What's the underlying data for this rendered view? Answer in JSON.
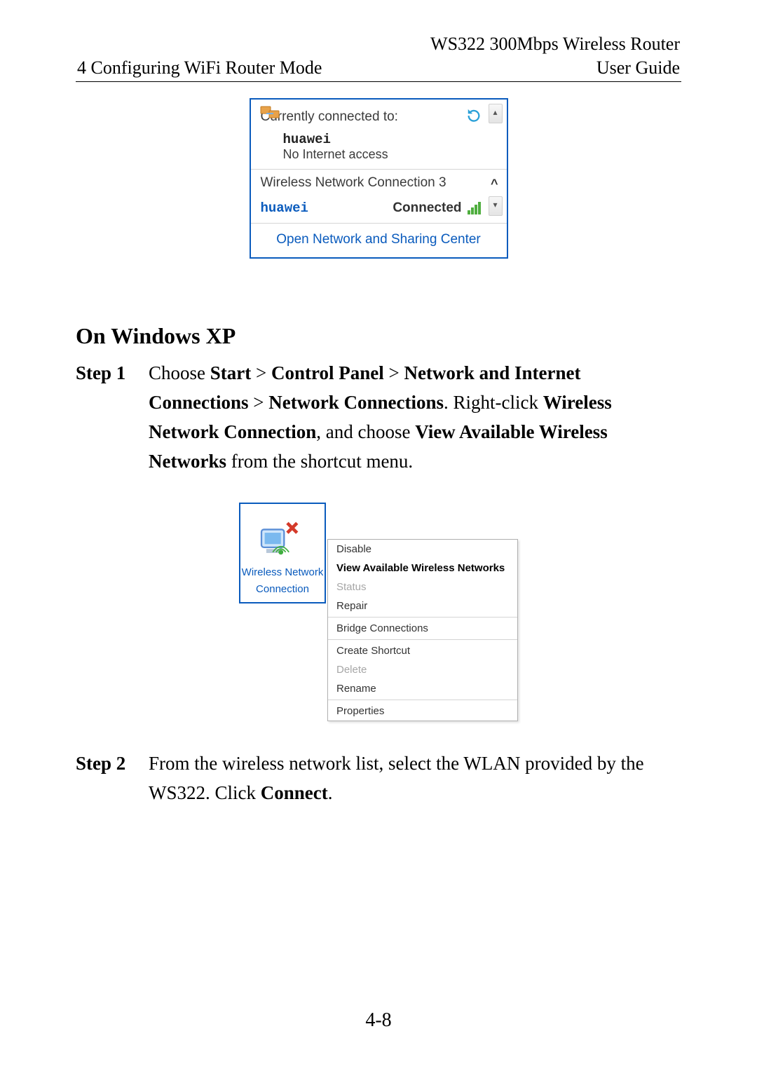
{
  "header": {
    "product": "WS322 300Mbps Wireless Router",
    "chapter": "4 Configuring WiFi Router Mode",
    "doc_type": "User Guide"
  },
  "figure1": {
    "currently": "Currently connected to:",
    "ssid": "huawei",
    "net_status": "No Internet access",
    "wlan_title": "Wireless Network Connection 3",
    "conn_ssid": "huawei",
    "conn_state": "Connected",
    "open_link": "Open Network and Sharing Center"
  },
  "section_heading": "On Windows XP",
  "step1": {
    "label": "Step 1",
    "pre": "Choose ",
    "b1": "Start",
    "gt1": " > ",
    "b2": "Control Panel",
    "gt2": " > ",
    "b3": "Network and Internet Connections",
    "gt3": " > ",
    "b4": "Network Connections",
    "mid1": ". Right-click ",
    "b5": "Wireless Network Connection",
    "mid2": ", and choose ",
    "b6": "View Available Wireless Networks",
    "tail": " from the shortcut menu."
  },
  "figure2": {
    "icon_label1": "Wireless Network",
    "icon_label2": "Connection",
    "menu": {
      "m1": "Disable",
      "m2": "View Available Wireless Networks",
      "m3": "Status",
      "m4": "Repair",
      "m5": "Bridge Connections",
      "m6": "Create Shortcut",
      "m7": "Delete",
      "m8": "Rename",
      "m9": "Properties"
    }
  },
  "step2": {
    "label": "Step 2",
    "pre": "From the wireless network list, select the WLAN provided by the WS322. Click ",
    "b1": "Connect",
    "tail": "."
  },
  "page_number": "4-8"
}
